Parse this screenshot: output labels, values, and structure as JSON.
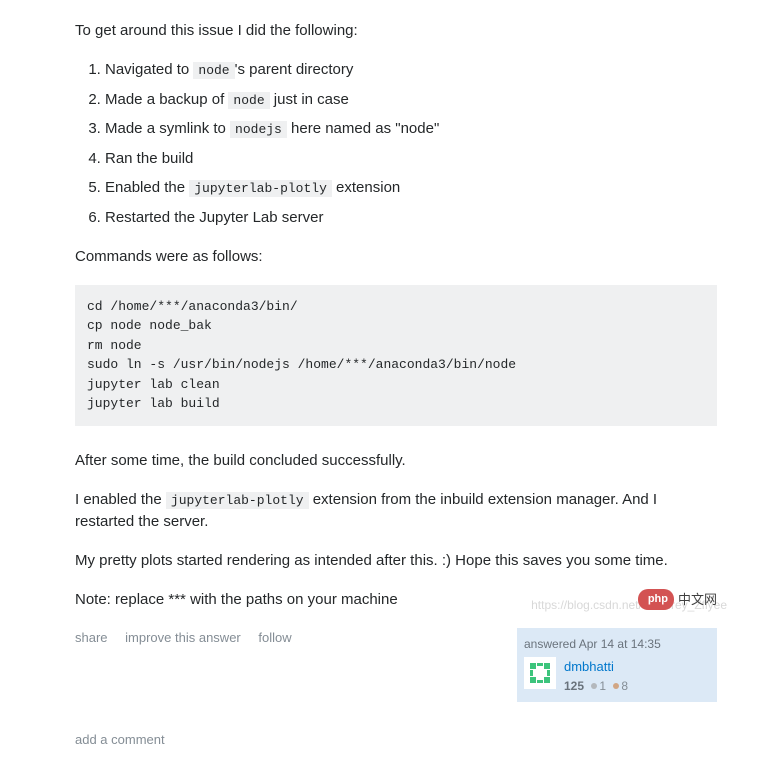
{
  "intro": "To get around this issue I did the following:",
  "steps": [
    {
      "pre": "Navigated to ",
      "code": "node",
      "post": "'s parent directory"
    },
    {
      "pre": "Made a backup of ",
      "code": "node",
      "post": " just in case"
    },
    {
      "pre": "Made a symlink to ",
      "code": "nodejs",
      "post": " here named as \"node\""
    },
    {
      "pre": "Ran the build",
      "code": null,
      "post": ""
    },
    {
      "pre": "Enabled the ",
      "code": "jupyterlab-plotly",
      "post": " extension"
    },
    {
      "pre": "Restarted the Jupyter Lab server",
      "code": null,
      "post": ""
    }
  ],
  "commands_intro": "Commands were as follows:",
  "code_block": "cd /home/***/anaconda3/bin/\ncp node node_bak\nrm node\nsudo ln -s /usr/bin/nodejs /home/***/anaconda3/bin/node\njupyter lab clean\njupyter lab build",
  "after_build": "After some time, the build concluded successfully.",
  "enabled": {
    "pre": "I enabled the ",
    "code": "jupyterlab-plotly",
    "post": " extension from the inbuild extension manager. And I restarted the server."
  },
  "pretty": "My pretty plots started rendering as intended after this. :) Hope this saves you some time.",
  "note": "Note: replace *** with the paths on your machine",
  "menu": {
    "share": "share",
    "improve": "improve this answer",
    "follow": "follow"
  },
  "user": {
    "action": "answered Apr 14 at 14:35",
    "name": "dmbhatti",
    "rep": "125",
    "silver": "1",
    "bronze": "8"
  },
  "add_comment": "add a comment",
  "watermark_url": "https://blog.csdn.net/Geoffrey_Zflyee",
  "watermark_cn": "中文网",
  "watermark_php": "php"
}
